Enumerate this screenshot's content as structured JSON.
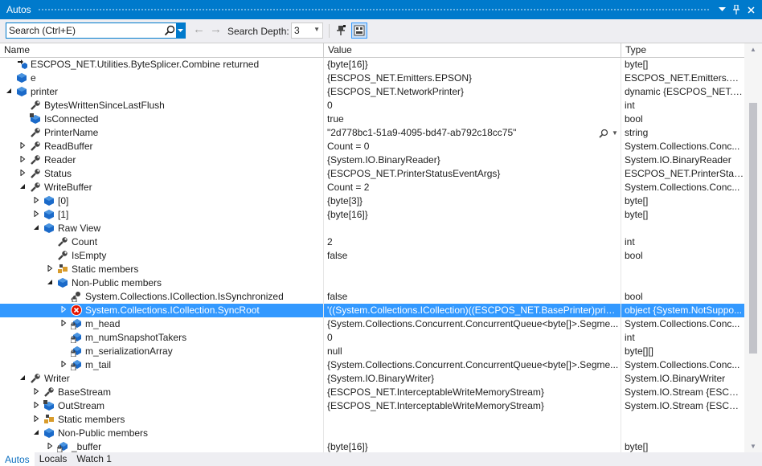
{
  "window": {
    "title": "Autos",
    "pin_label": "↕",
    "colors": {
      "accent": "#007acc",
      "selection": "#3399ff"
    }
  },
  "toolbar": {
    "search_placeholder": "Search (Ctrl+E)",
    "search_depth_label": "Search Depth:",
    "search_depth_value": "3"
  },
  "columns": {
    "name": "Name",
    "value": "Value",
    "type": "Type"
  },
  "rows": [
    {
      "indent": 0,
      "expander": "none",
      "icon": "return-icon",
      "name": "ESCPOS_NET.Utilities.ByteSplicer.Combine returned",
      "value": "{byte[16]}",
      "type": "byte[]"
    },
    {
      "indent": 0,
      "expander": "none",
      "icon": "variable-icon",
      "name": "e",
      "value": "{ESCPOS_NET.Emitters.EPSON}",
      "type": "ESCPOS_NET.Emitters.EPS..."
    },
    {
      "indent": 0,
      "expander": "expanded",
      "icon": "variable-icon",
      "name": "printer",
      "value": "{ESCPOS_NET.NetworkPrinter}",
      "type": "dynamic {ESCPOS_NET.N..."
    },
    {
      "indent": 1,
      "expander": "none",
      "icon": "property-icon",
      "name": "BytesWrittenSinceLastFlush",
      "value": "0",
      "type": "int"
    },
    {
      "indent": 1,
      "expander": "none",
      "icon": "field-icon",
      "name": "IsConnected",
      "value": "true",
      "type": "bool"
    },
    {
      "indent": 1,
      "expander": "none",
      "icon": "property-icon",
      "name": "PrinterName",
      "value": "\"2d778bc1-51a9-4095-bd47-ab792c18cc75\"",
      "type": "string",
      "magnify": true
    },
    {
      "indent": 1,
      "expander": "collapsed",
      "icon": "property-icon",
      "name": "ReadBuffer",
      "value": "Count = 0",
      "type": "System.Collections.Conc..."
    },
    {
      "indent": 1,
      "expander": "collapsed",
      "icon": "property-icon",
      "name": "Reader",
      "value": "{System.IO.BinaryReader}",
      "type": "System.IO.BinaryReader"
    },
    {
      "indent": 1,
      "expander": "collapsed",
      "icon": "property-icon",
      "name": "Status",
      "value": "{ESCPOS_NET.PrinterStatusEventArgs}",
      "type": "ESCPOS_NET.PrinterStatu..."
    },
    {
      "indent": 1,
      "expander": "expanded",
      "icon": "property-icon",
      "name": "WriteBuffer",
      "value": "Count = 2",
      "type": "System.Collections.Conc..."
    },
    {
      "indent": 2,
      "expander": "collapsed",
      "icon": "variable-icon",
      "name": "[0]",
      "value": "{byte[3]}",
      "type": "byte[]"
    },
    {
      "indent": 2,
      "expander": "collapsed",
      "icon": "variable-icon",
      "name": "[1]",
      "value": "{byte[16]}",
      "type": "byte[]"
    },
    {
      "indent": 2,
      "expander": "expanded",
      "icon": "variable-icon",
      "name": "Raw View",
      "value": "",
      "type": ""
    },
    {
      "indent": 3,
      "expander": "none",
      "icon": "property-icon",
      "name": "Count",
      "value": "2",
      "type": "int"
    },
    {
      "indent": 3,
      "expander": "none",
      "icon": "property-icon",
      "name": "IsEmpty",
      "value": "false",
      "type": "bool"
    },
    {
      "indent": 3,
      "expander": "collapsed",
      "icon": "static-members-icon",
      "name": "Static members",
      "value": "",
      "type": ""
    },
    {
      "indent": 3,
      "expander": "expanded",
      "icon": "variable-icon",
      "name": "Non-Public members",
      "value": "",
      "type": ""
    },
    {
      "indent": 4,
      "expander": "none",
      "icon": "private-property-icon",
      "name": "System.Collections.ICollection.IsSynchronized",
      "value": "false",
      "type": "bool"
    },
    {
      "indent": 4,
      "expander": "collapsed",
      "icon": "error-icon",
      "name": "System.Collections.ICollection.SyncRoot",
      "value": "'((System.Collections.ICollection)((ESCPOS_NET.BasePrinter)printer)...",
      "type": "object {System.NotSuppo...",
      "selected": true
    },
    {
      "indent": 4,
      "expander": "collapsed",
      "icon": "private-field-icon",
      "name": "m_head",
      "value": "{System.Collections.Concurrent.ConcurrentQueue<byte[]>.Segme...",
      "type": "System.Collections.Conc..."
    },
    {
      "indent": 4,
      "expander": "none",
      "icon": "private-field-icon",
      "name": "m_numSnapshotTakers",
      "value": "0",
      "type": "int"
    },
    {
      "indent": 4,
      "expander": "none",
      "icon": "private-field-icon",
      "name": "m_serializationArray",
      "value": "null",
      "type": "byte[][]"
    },
    {
      "indent": 4,
      "expander": "collapsed",
      "icon": "private-field-icon",
      "name": "m_tail",
      "value": "{System.Collections.Concurrent.ConcurrentQueue<byte[]>.Segme...",
      "type": "System.Collections.Conc..."
    },
    {
      "indent": 1,
      "expander": "expanded",
      "icon": "property-icon",
      "name": "Writer",
      "value": "{System.IO.BinaryWriter}",
      "type": "System.IO.BinaryWriter"
    },
    {
      "indent": 2,
      "expander": "collapsed",
      "icon": "property-icon",
      "name": "BaseStream",
      "value": "{ESCPOS_NET.InterceptableWriteMemoryStream}",
      "type": "System.IO.Stream {ESCPO..."
    },
    {
      "indent": 2,
      "expander": "collapsed",
      "icon": "field-icon",
      "name": "OutStream",
      "value": "{ESCPOS_NET.InterceptableWriteMemoryStream}",
      "type": "System.IO.Stream {ESCPO..."
    },
    {
      "indent": 2,
      "expander": "collapsed",
      "icon": "static-members-icon",
      "name": "Static members",
      "value": "",
      "type": ""
    },
    {
      "indent": 2,
      "expander": "expanded",
      "icon": "variable-icon",
      "name": "Non-Public members",
      "value": "",
      "type": ""
    },
    {
      "indent": 3,
      "expander": "collapsed",
      "icon": "private-field-icon",
      "name": "_buffer",
      "value": "{byte[16]}",
      "type": "byte[]"
    }
  ],
  "bottom_tabs": [
    {
      "label": "Autos",
      "active": true
    },
    {
      "label": "Locals",
      "active": false
    },
    {
      "label": "Watch 1",
      "active": false
    }
  ]
}
